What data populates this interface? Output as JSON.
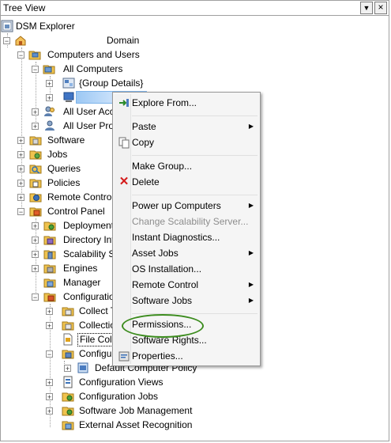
{
  "header": {
    "title": "Tree View"
  },
  "tree": {
    "root": "DSM Explorer",
    "domain": "Domain",
    "computers_and_users": "Computers and Users",
    "all_computers": "All Computers",
    "group_details": "{Group Details}",
    "all_user_accounts": "All User Acc",
    "all_user_profiles": "All User Prof",
    "software": "Software",
    "jobs": "Jobs",
    "queries": "Queries",
    "policies": "Policies",
    "remote_control": "Remote Control",
    "control_panel": "Control Panel",
    "deployment": "Deployment",
    "directory_integration": "Directory Int",
    "scalability": "Scalability S",
    "engines": "Engines",
    "manager": "Manager",
    "configuration": "Configuration",
    "collect_tasks": "Collect T",
    "collection": "Collectio",
    "file_collection": "File Coll",
    "configuration_policy": "Configu",
    "default_computer_policy": "Default Computer Policy",
    "configuration_views": "Configuration Views",
    "configuration_jobs": "Configuration Jobs",
    "software_job_management": "Software Job Management",
    "external_asset_recognition": "External Asset Recognition"
  },
  "context_menu": {
    "explore_from": "Explore From...",
    "paste": "Paste",
    "copy": "Copy",
    "make_group": "Make Group...",
    "delete": "Delete",
    "power_up": "Power up Computers",
    "change_scalability": "Change Scalability Server...",
    "instant_diagnostics": "Instant Diagnostics...",
    "asset_jobs": "Asset Jobs",
    "os_installation": "OS Installation...",
    "remote_control": "Remote Control",
    "software_jobs": "Software Jobs",
    "permissions": "Permissions...",
    "software_rights": "Software Rights...",
    "properties": "Properties..."
  }
}
